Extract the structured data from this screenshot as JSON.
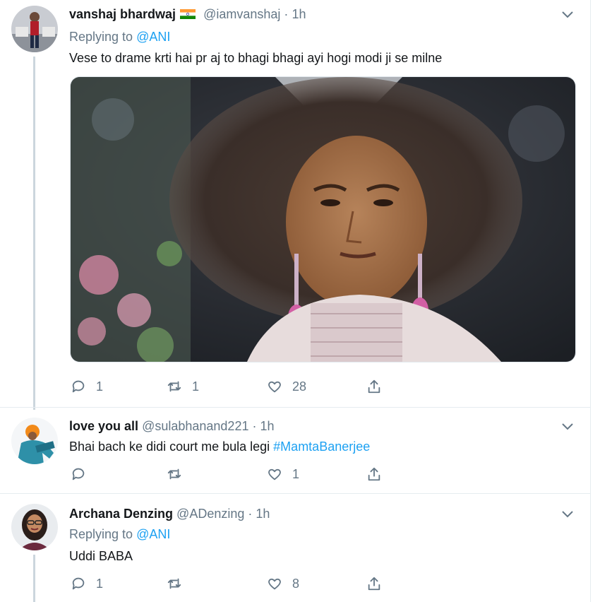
{
  "tweets": [
    {
      "name": "vanshaj bhardwaj",
      "flag_icon": "india-flag-icon",
      "handle": "@iamvanshaj",
      "time": "1h",
      "replying_prefix": "Replying to ",
      "replying_mention": "@ANI",
      "text": "Vese to drame krti hai pr aj to bhagi bhagi ayi hogi  modi ji se milne",
      "replies": "1",
      "retweets": "1",
      "likes": "28"
    },
    {
      "name": "love you all",
      "handle": "@sulabhanand221",
      "time": "1h",
      "text": "Bhai bach ke didi court me bula legi ",
      "hashtag": "#MamtaBanerjee",
      "replies": "",
      "retweets": "",
      "likes": "1"
    },
    {
      "name": "Archana Denzing",
      "handle": "@ADenzing",
      "time": "1h",
      "replying_prefix": "Replying to ",
      "replying_mention": "@ANI",
      "text": "Uddi BABA",
      "replies": "1",
      "retweets": "",
      "likes": "8"
    }
  ],
  "separator": "·",
  "colors": {
    "link": "#1da1f2",
    "muted": "#657786",
    "border": "#e6ecf0"
  }
}
